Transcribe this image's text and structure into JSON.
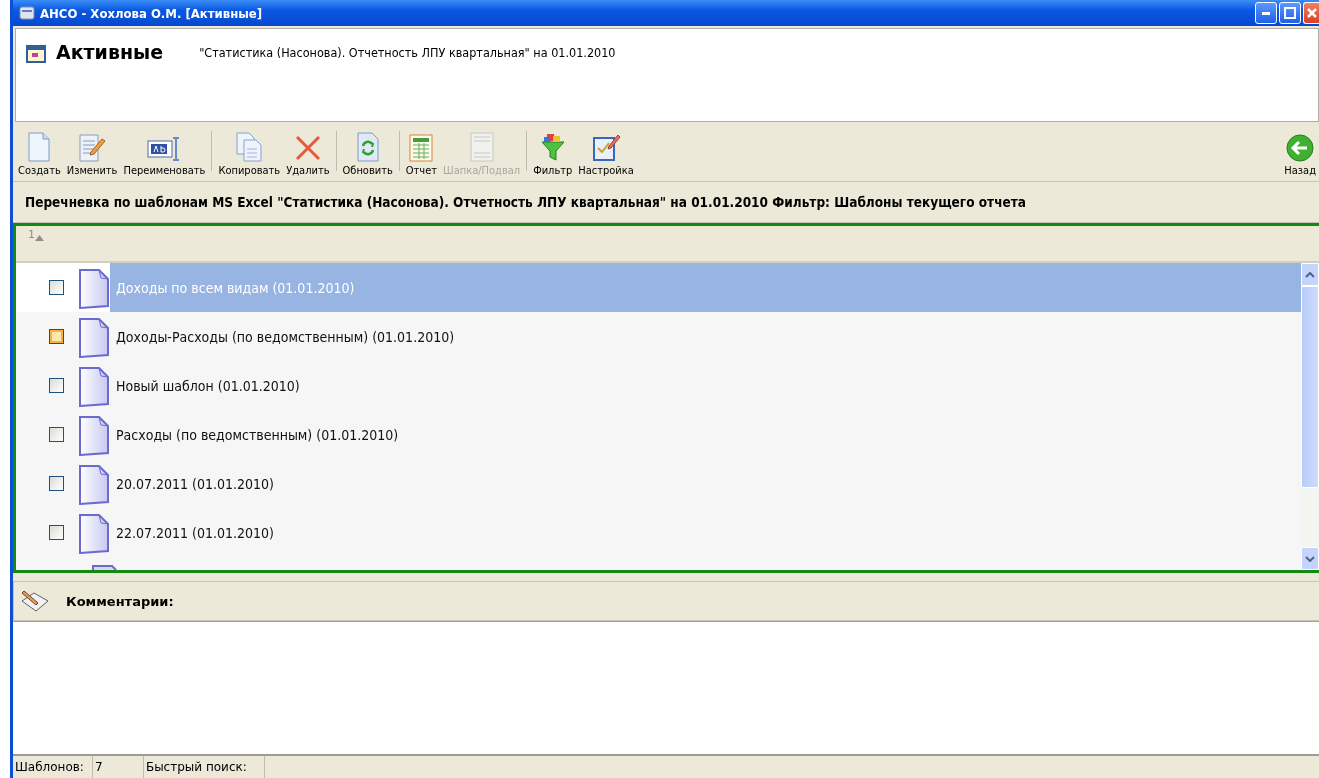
{
  "window": {
    "title": "АНСО - Хохлова О.М. [Активные]"
  },
  "header": {
    "title": "Активные",
    "subtitle": "\"Статистика (Насонова). Отчетность ЛПУ квартальная\"  на 01.01.2010"
  },
  "toolbar": {
    "groups": [
      [
        {
          "label": "Создать",
          "kind": "new",
          "disabled": false
        },
        {
          "label": "Изменить",
          "kind": "edit",
          "disabled": false
        },
        {
          "label": "Переименовать",
          "kind": "rename",
          "disabled": false
        }
      ],
      [
        {
          "label": "Копировать",
          "kind": "copy",
          "disabled": false
        },
        {
          "label": "Удалить",
          "kind": "delete",
          "disabled": false
        }
      ],
      [
        {
          "label": "Обновить",
          "kind": "refresh",
          "disabled": false
        }
      ],
      [
        {
          "label": "Отчет",
          "kind": "report",
          "disabled": false
        },
        {
          "label": "Шапка/Подвал",
          "kind": "header",
          "disabled": true
        }
      ],
      [
        {
          "label": "Фильтр",
          "kind": "filter",
          "disabled": false
        },
        {
          "label": "Настройка",
          "kind": "settings",
          "disabled": false
        }
      ]
    ],
    "back": {
      "label": "Назад",
      "kind": "back",
      "disabled": false
    }
  },
  "info_bar": "Перечневка по шаблонам MS Excel  \"Статистика (Насонова). Отчетность ЛПУ квартальная\" на 01.01.2010   Фильтр: Шаблоны текущего отчета",
  "list": {
    "column_1": "1",
    "rows": [
      {
        "label": "Доходы по всем видам (01.01.2010)",
        "checked": false,
        "hovered": false,
        "selected": true
      },
      {
        "label": "Доходы-Расходы (по ведомственным) (01.01.2010)",
        "checked": false,
        "hovered": true,
        "selected": false
      },
      {
        "label": "Новый шаблон (01.01.2010)",
        "checked": false,
        "hovered": false,
        "selected": false
      },
      {
        "label": "Расходы (по ведомственным) (01.01.2010)",
        "checked": false,
        "hovered": false,
        "selected": false
      },
      {
        "label": "20.07.2011 (01.01.2010)",
        "checked": false,
        "hovered": false,
        "selected": false
      },
      {
        "label": "22.07.2011 (01.01.2010)",
        "checked": false,
        "hovered": false,
        "selected": false
      }
    ]
  },
  "comments": {
    "title": "Комментарии:"
  },
  "status_bar": {
    "count_label": "Шаблонов:",
    "count": "7",
    "search_label": "Быстрый поиск:"
  }
}
